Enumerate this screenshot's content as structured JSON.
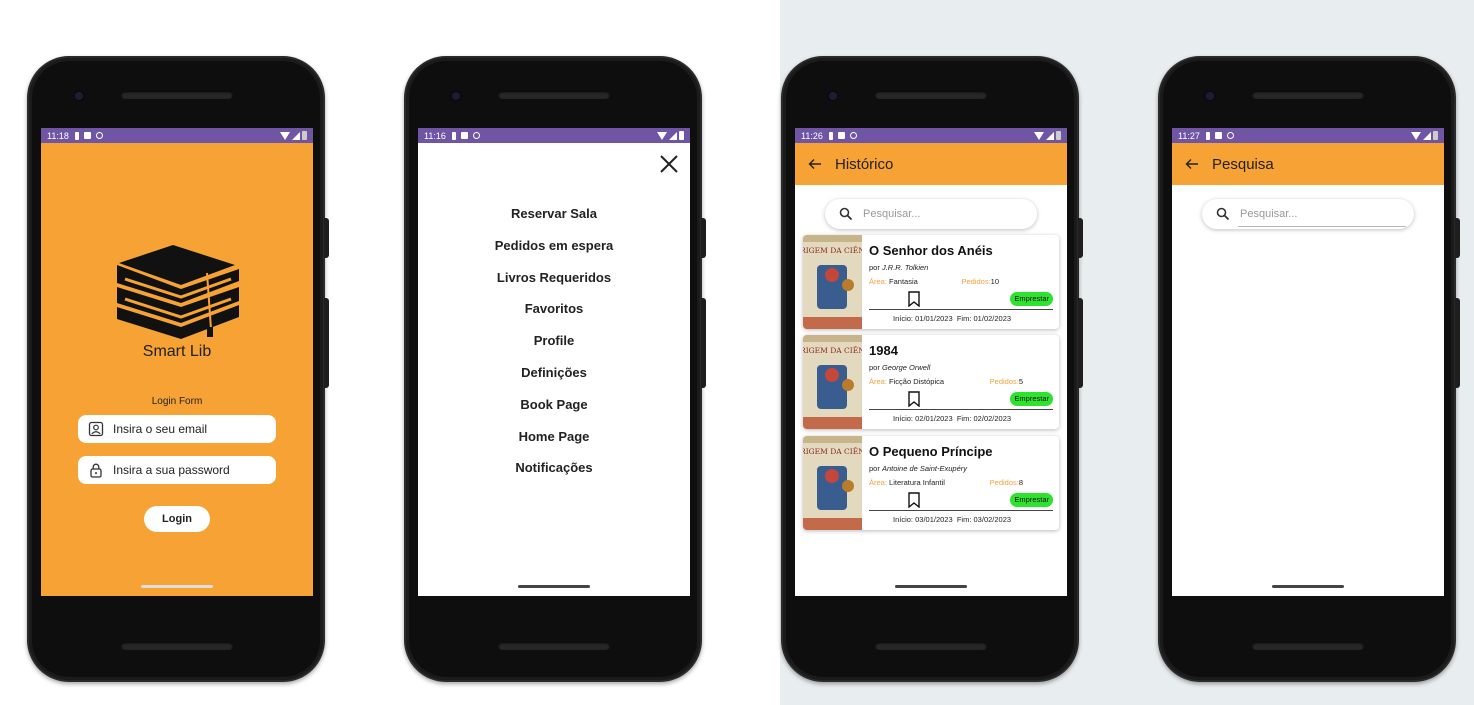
{
  "login_screen": {
    "status_time": "11:18",
    "app_name": "Smart Lib",
    "form_title": "Login Form",
    "email_placeholder": "Insira o seu email",
    "password_placeholder": "Insira a sua password",
    "login_button": "Login",
    "logo_icon": "books-stack-icon",
    "background_color": "#f7a234"
  },
  "menu_screen": {
    "status_time": "11:16",
    "items": [
      "Reservar Sala",
      "Pedidos em espera",
      "Livros Requeridos",
      "Favoritos",
      "Profile",
      "Definições",
      "Book Page",
      "Home Page",
      "Notificações"
    ],
    "close_icon": "close-icon"
  },
  "history_screen": {
    "status_time": "11:26",
    "title": "Histórico",
    "search_placeholder": "Pesquisar...",
    "labels": {
      "by": "por",
      "area": "Área:",
      "requests": "Pedidos:",
      "start": "Início:",
      "end": "Fim:",
      "borrow": "Emprestar"
    },
    "books": [
      {
        "title": "O Senhor dos Anéis",
        "author": "J.R.R. Tolkien",
        "area": "Fantasia",
        "requests": "10",
        "start": "01/01/2023",
        "end": "01/02/2023",
        "cover_text": "A ORIGEM DA CIÊNCIA"
      },
      {
        "title": "1984",
        "author": "George Orwell",
        "area": "Ficção Distópica",
        "requests": "5",
        "start": "02/01/2023",
        "end": "02/02/2023",
        "cover_text": "A ORIGEM DA CIÊNCIA"
      },
      {
        "title": "O Pequeno Príncipe",
        "author": "Antoine de Saint-Exupéry",
        "area": "Literatura Infantil",
        "requests": "8",
        "start": "03/01/2023",
        "end": "03/02/2023",
        "cover_text": "A ORIGEM DA CIÊNCIA"
      }
    ]
  },
  "search_screen": {
    "status_time": "11:27",
    "title": "Pesquisa",
    "search_placeholder": "Pesquisar..."
  },
  "colors": {
    "accent": "#f7a234",
    "status_bar": "#6f55a3",
    "borrow_button": "#2ee32e",
    "label_orange": "#f2a23a"
  }
}
